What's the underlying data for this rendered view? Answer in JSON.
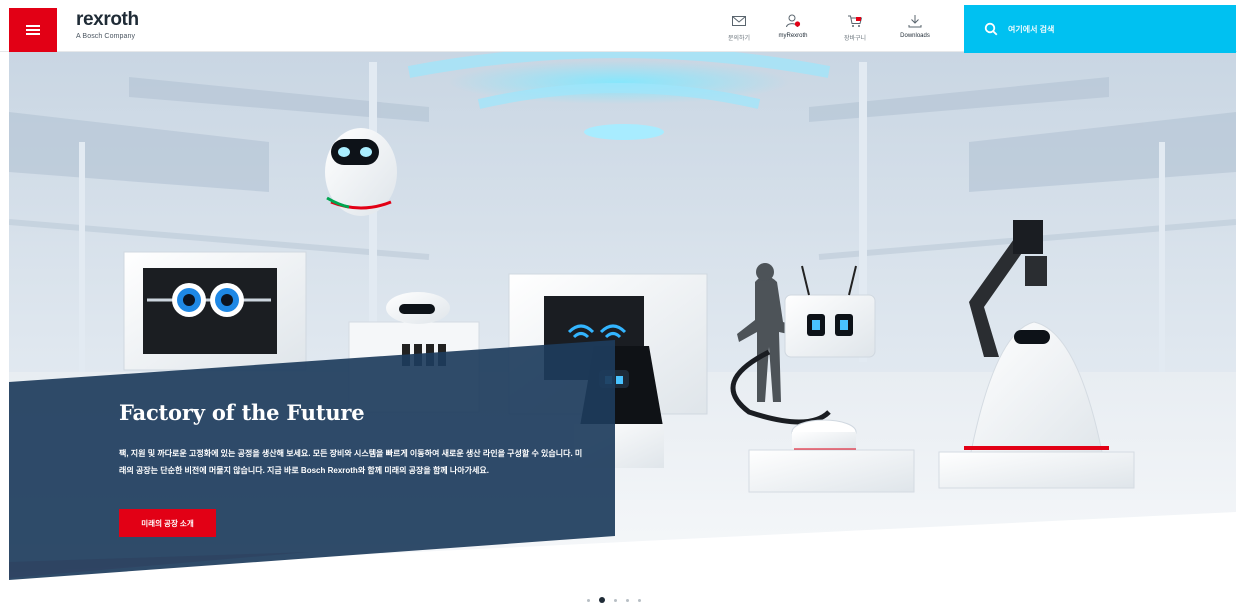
{
  "header": {
    "menu_icon": "hamburger-icon",
    "logo_text": "rexroth",
    "logo_sub": "A Bosch Company",
    "nav": [
      {
        "id": "contact",
        "icon": "mail-icon",
        "label": "문의하기"
      },
      {
        "id": "myrexroth",
        "icon": "user-icon",
        "label": "myRexroth"
      },
      {
        "id": "cart",
        "icon": "cart-icon",
        "label": "장바구니"
      },
      {
        "id": "downloads",
        "icon": "download-icon",
        "label": "Downloads"
      }
    ],
    "search": {
      "icon": "search-icon",
      "placeholder": "여기에서 검색"
    }
  },
  "hero": {
    "title": "Factory of the Future",
    "description": "팩, 지원 및 까다로운 고정화에 있는 공정을 생산해 보세요. 모든 장비와 시스템을 빠르게 이동하여 새로운 생산 라인을 구성할 수 있습니다. 미래의 공장는 단순한 비전에 머물지 않습니다. 지금 바로 Bosch Rexroth와 함께 미래의 공장을 함께 나아가세요.",
    "cta_label": "미래의 공장 소개",
    "accent_color": "#e20015",
    "panel_color": "#1d3c5c",
    "search_color": "#00c1f1"
  },
  "carousel": {
    "slide_count": 5,
    "active_index": 1
  }
}
